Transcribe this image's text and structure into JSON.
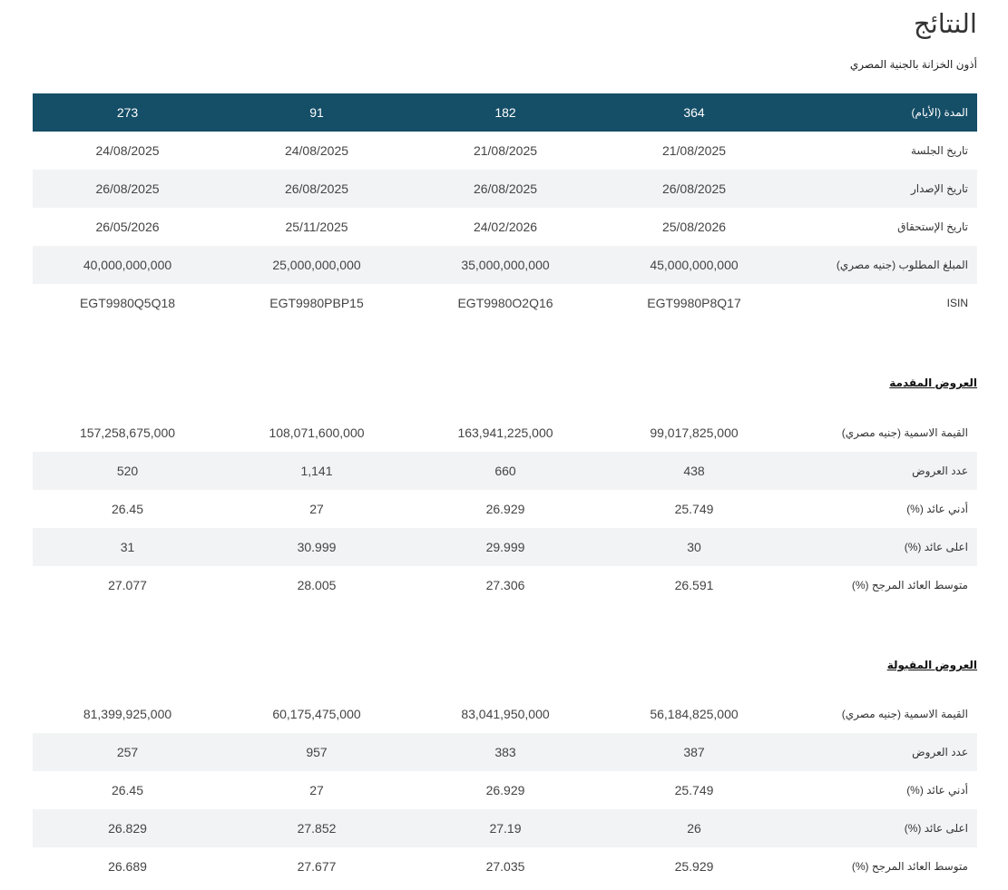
{
  "header": {
    "title": "النتائج",
    "subtitle": "أذون الخزانة بالجنية المصري"
  },
  "results": {
    "header_label": "المدة (الأيام)",
    "columns": [
      "364",
      "182",
      "91",
      "273"
    ],
    "rows": [
      {
        "label": "تاريخ الجلسة",
        "values": [
          "21/08/2025",
          "21/08/2025",
          "24/08/2025",
          "24/08/2025"
        ]
      },
      {
        "label": "تاريخ الإصدار",
        "values": [
          "26/08/2025",
          "26/08/2025",
          "26/08/2025",
          "26/08/2025"
        ]
      },
      {
        "label": "تاريخ الإستحقاق",
        "values": [
          "25/08/2026",
          "24/02/2026",
          "25/11/2025",
          "26/05/2026"
        ]
      },
      {
        "label": "المبلغ المطلوب (جنيه مصري)",
        "values": [
          "45,000,000,000",
          "35,000,000,000",
          "25,000,000,000",
          "40,000,000,000"
        ]
      },
      {
        "label": "ISIN",
        "values": [
          "EGT9980P8Q17",
          "EGT9980O2Q16",
          "EGT9980PBP15",
          "EGT9980Q5Q18"
        ]
      }
    ]
  },
  "offers": {
    "heading": "العروض المقدمة",
    "rows": [
      {
        "label": "القيمة الاسمية (جنيه مصري)",
        "values": [
          "99,017,825,000",
          "163,941,225,000",
          "108,071,600,000",
          "157,258,675,000"
        ]
      },
      {
        "label": "عدد العروض",
        "values": [
          "438",
          "660",
          "1,141",
          "520"
        ]
      },
      {
        "label": "أدني عائد (%)",
        "values": [
          "25.749",
          "26.929",
          "27",
          "26.45"
        ]
      },
      {
        "label": "اعلى عائد (%)",
        "values": [
          "30",
          "29.999",
          "30.999",
          "31"
        ]
      },
      {
        "label": "متوسط العائد المرجح (%)",
        "values": [
          "26.591",
          "27.306",
          "28.005",
          "27.077"
        ]
      }
    ]
  },
  "accepted": {
    "heading": "العروض المقبولة",
    "rows": [
      {
        "label": "القيمة الاسمية (جنيه مصري)",
        "values": [
          "56,184,825,000",
          "83,041,950,000",
          "60,175,475,000",
          "81,399,925,000"
        ]
      },
      {
        "label": "عدد العروض",
        "values": [
          "387",
          "383",
          "957",
          "257"
        ]
      },
      {
        "label": "أدني عائد (%)",
        "values": [
          "25.749",
          "26.929",
          "27",
          "26.45"
        ]
      },
      {
        "label": "اعلى عائد (%)",
        "values": [
          "26",
          "27.19",
          "27.852",
          "26.829"
        ]
      },
      {
        "label": "متوسط العائد المرجح (%)",
        "values": [
          "25.929",
          "27.035",
          "27.677",
          "26.689"
        ]
      }
    ]
  }
}
